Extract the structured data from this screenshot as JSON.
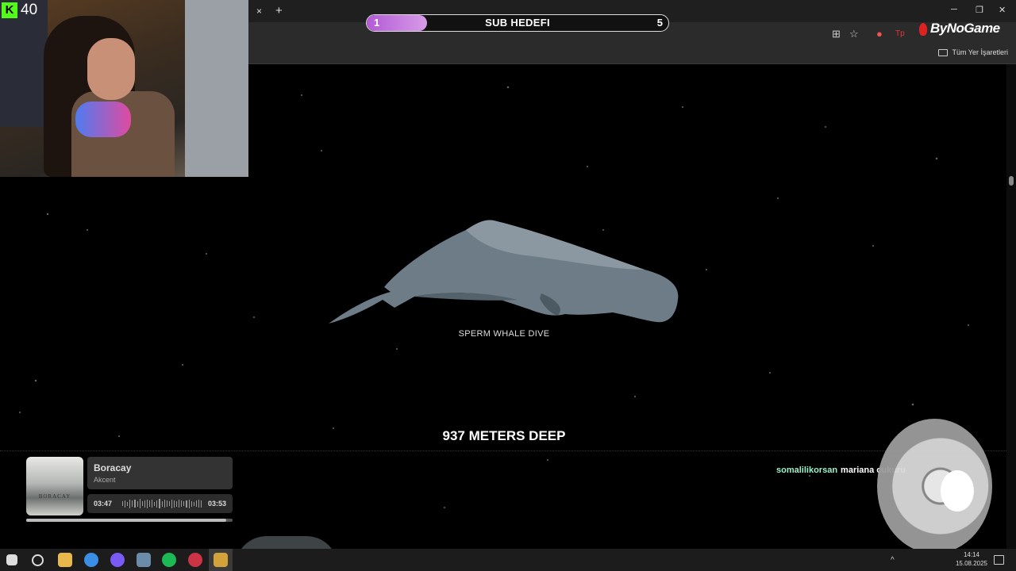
{
  "overlay": {
    "counter": "40",
    "kick_letter": "K",
    "subgoal": {
      "title": "SUB HEDEFI",
      "start": "1",
      "end": "5",
      "progress": 0.2
    },
    "brand": "ByNoGame"
  },
  "browser": {
    "tab_close": "×",
    "new_tab": "+",
    "bookmarks_label": "Tüm Yer İşaretleri"
  },
  "page": {
    "creature_label": "SPERM WHALE DIVE",
    "depth_text": "937 METERS DEEP"
  },
  "chat": {
    "user": "somalilikorsan",
    "message": "mariana çukuru"
  },
  "music": {
    "title": "Boracay",
    "artist": "Akcent",
    "current_time": "03:47",
    "total_time": "03:53",
    "album_text": "BORACAY",
    "progress": 0.97
  },
  "taskbar": {
    "time": "14:14",
    "date": "15.08.2025"
  },
  "colors": {
    "subgoal_fill": "#c070e0",
    "chat_user": "#9ef0c9",
    "kick_green": "#53fc18"
  }
}
